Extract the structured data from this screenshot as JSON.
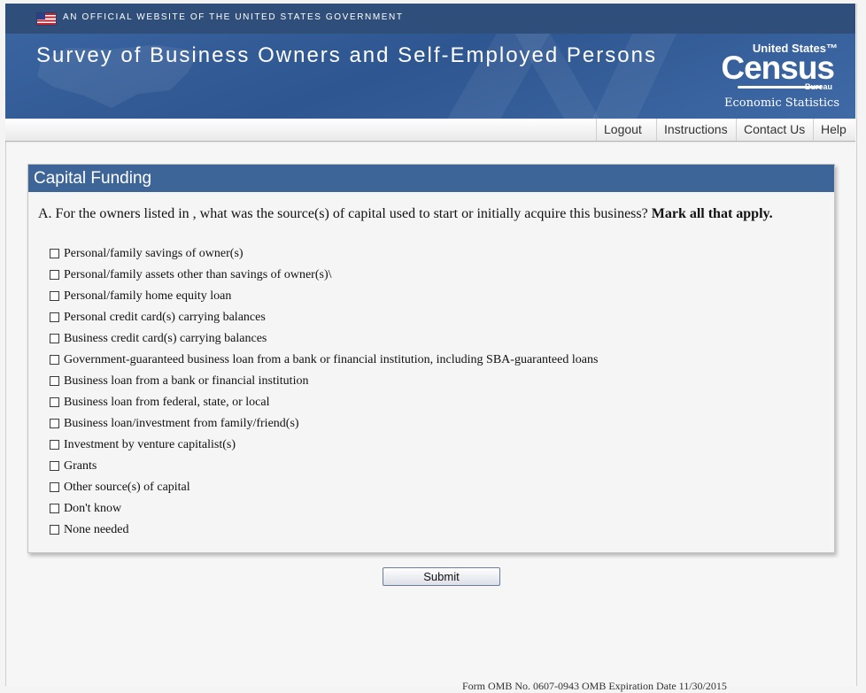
{
  "gov_banner": {
    "text": "AN OFFICIAL WEBSITE OF THE UNITED STATES GOVERNMENT"
  },
  "header": {
    "title": "Survey of Business Owners and Self-Employed Persons",
    "logo": {
      "united_states": "United States™",
      "census": "Census",
      "bureau": "Bureau",
      "tagline": "Economic Statistics"
    }
  },
  "nav": {
    "items": [
      {
        "label": "Logout"
      },
      {
        "label": "Instructions"
      },
      {
        "label": "Contact Us"
      },
      {
        "label": "Help"
      }
    ]
  },
  "panel": {
    "title": "Capital Funding",
    "question_text": "A. For the owners listed in , what was the source(s) of capital used to start or initially acquire this business? ",
    "question_bold": "Mark all that apply.",
    "options": [
      {
        "label": "Personal/family savings of owner(s)",
        "checked": false
      },
      {
        "label": "Personal/family assets other than savings of owner(s)\\",
        "checked": false
      },
      {
        "label": "Personal/family home equity loan",
        "checked": false
      },
      {
        "label": "Personal credit card(s) carrying balances",
        "checked": false
      },
      {
        "label": "Business credit card(s) carrying balances",
        "checked": false
      },
      {
        "label": "Government-guaranteed business loan from a bank or financial institution, including SBA-guaranteed loans",
        "checked": false
      },
      {
        "label": "Business loan from a bank or financial institution",
        "checked": false
      },
      {
        "label": "Business loan from federal, state, or local",
        "checked": false
      },
      {
        "label": "Business loan/investment from family/friend(s)",
        "checked": false
      },
      {
        "label": "Investment by venture capitalist(s)",
        "checked": false
      },
      {
        "label": "Grants",
        "checked": false
      },
      {
        "label": "Other source(s) of capital",
        "checked": false
      },
      {
        "label": "Don't know",
        "checked": false
      },
      {
        "label": "None needed",
        "checked": false
      }
    ]
  },
  "actions": {
    "submit_label": "Submit"
  },
  "footer": {
    "text": "Form  OMB No. 0607-0943   OMB Expiration Date 11/30/2015"
  },
  "colors": {
    "gov_bar": "#2f4f7a",
    "banner": "#3a64a0",
    "panel_header": "#3d6597",
    "page_bg": "#f4f4f4"
  }
}
